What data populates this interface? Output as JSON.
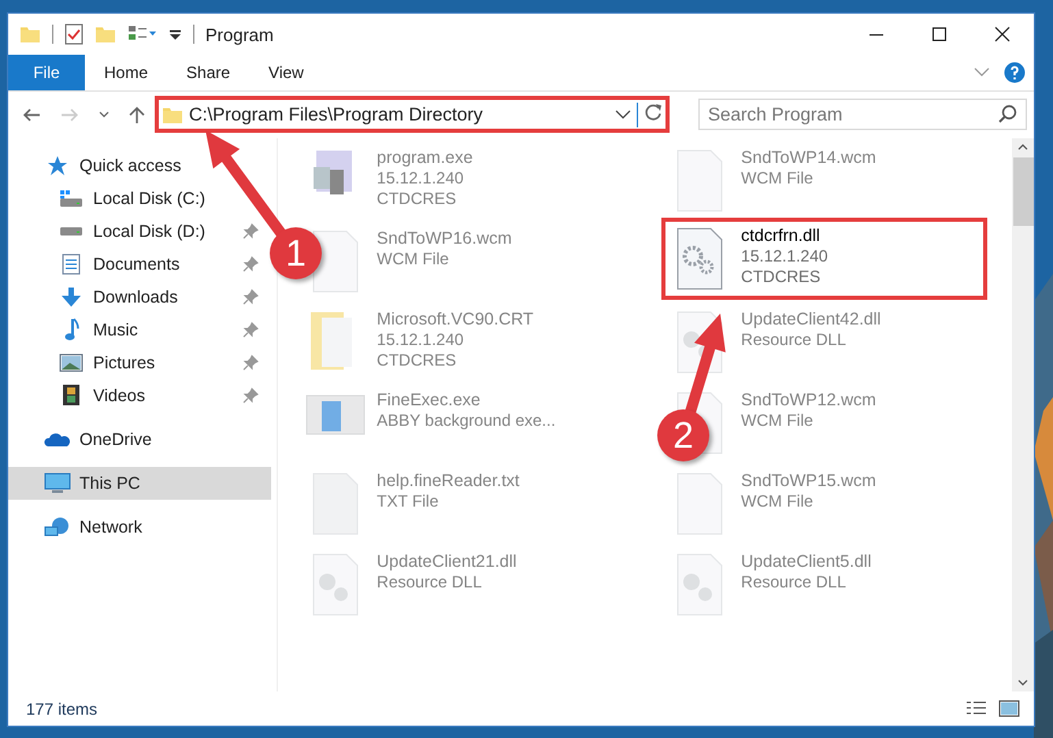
{
  "window": {
    "title": "Program"
  },
  "ribbon": {
    "tabs": [
      {
        "label": "File",
        "kind": "file"
      },
      {
        "label": "Home",
        "kind": "tab"
      },
      {
        "label": "Share",
        "kind": "tab"
      },
      {
        "label": "View",
        "kind": "tab"
      }
    ]
  },
  "address_bar": {
    "path": "C:\\Program Files\\Program Directory",
    "highlighted": true
  },
  "search": {
    "placeholder": "Search Program"
  },
  "sidebar": {
    "items": [
      {
        "label": "Quick access",
        "kind": "star",
        "selected": false,
        "children": [
          {
            "label": "Local Disk (C:)",
            "kind": "drive-win",
            "pinned": false,
            "selected": false
          },
          {
            "label": "Local Disk (D:)",
            "kind": "drive",
            "pinned": true,
            "selected": false
          },
          {
            "label": "Documents",
            "kind": "document",
            "pinned": true,
            "selected": false
          },
          {
            "label": "Downloads",
            "kind": "download",
            "pinned": true,
            "selected": false
          },
          {
            "label": "Music",
            "kind": "music",
            "pinned": true,
            "selected": false
          },
          {
            "label": "Pictures",
            "kind": "pictures",
            "pinned": true,
            "selected": false
          },
          {
            "label": "Videos",
            "kind": "videos",
            "pinned": true,
            "selected": false
          }
        ]
      },
      {
        "label": "OneDrive",
        "kind": "cloud",
        "selected": false
      },
      {
        "label": "This PC",
        "kind": "pc",
        "selected": true
      },
      {
        "label": "Network",
        "kind": "network",
        "selected": false
      }
    ]
  },
  "files": [
    {
      "name": "program.exe",
      "details": [
        "15.12.1.240",
        "CTDCRES"
      ],
      "kind": "app",
      "dimmed": true,
      "highlighted": false
    },
    {
      "name": "SndToWP14.wcm",
      "details": [
        "WCM File"
      ],
      "kind": "blank",
      "dimmed": true,
      "highlighted": false
    },
    {
      "name": "SndToWP16.wcm",
      "details": [
        "WCM File"
      ],
      "kind": "blank",
      "dimmed": true,
      "highlighted": false
    },
    {
      "name": "ctdcrfrn.dll",
      "details": [
        "15.12.1.240",
        "CTDCRES"
      ],
      "kind": "gears",
      "dimmed": false,
      "highlighted": true
    },
    {
      "name": "Microsoft.VC90.CRT",
      "details": [
        "15.12.1.240",
        "CTDCRES"
      ],
      "kind": "folder",
      "dimmed": true,
      "highlighted": false
    },
    {
      "name": "UpdateClient42.dll",
      "details": [
        "Resource DLL"
      ],
      "kind": "dll",
      "dimmed": true,
      "highlighted": false
    },
    {
      "name": "FineExec.exe",
      "details": [
        "ABBY background exe..."
      ],
      "kind": "window",
      "dimmed": true,
      "highlighted": false
    },
    {
      "name": "SndToWP12.wcm",
      "details": [
        "WCM File"
      ],
      "kind": "blank",
      "dimmed": true,
      "highlighted": false
    },
    {
      "name": "help.fineReader.txt",
      "details": [
        "TXT File"
      ],
      "kind": "text",
      "dimmed": true,
      "highlighted": false
    },
    {
      "name": "SndToWP15.wcm",
      "details": [
        "WCM File"
      ],
      "kind": "blank",
      "dimmed": true,
      "highlighted": false
    },
    {
      "name": "UpdateClient21.dll",
      "details": [
        "Resource DLL"
      ],
      "kind": "dll",
      "dimmed": true,
      "highlighted": false
    },
    {
      "name": "UpdateClient5.dll",
      "details": [
        "Resource DLL"
      ],
      "kind": "dll",
      "dimmed": true,
      "highlighted": false
    }
  ],
  "status_bar": {
    "item_count": "177 items"
  },
  "annotations": [
    {
      "number": "1"
    },
    {
      "number": "2"
    }
  ]
}
